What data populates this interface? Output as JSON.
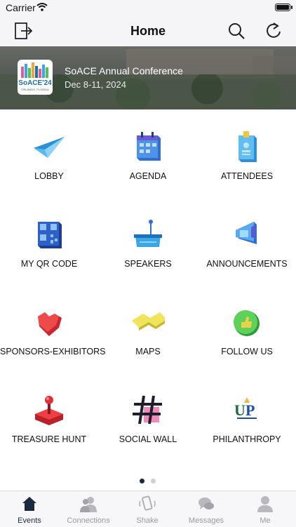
{
  "status_bar": {
    "carrier": "Carrier"
  },
  "navbar": {
    "title": "Home"
  },
  "event": {
    "title": "SoACE Annual Conference",
    "dates": "Dec 8-11, 2024",
    "logo_text": "SoACE'24",
    "logo_subtext": "ORLANDO, FLORIDA"
  },
  "grid": {
    "tiles": [
      {
        "label": "LOBBY",
        "icon": "paper-plane-icon",
        "color": "#3aa6e6"
      },
      {
        "label": "AGENDA",
        "icon": "calendar-icon",
        "color": "#3f7fe0"
      },
      {
        "label": "ATTENDEES",
        "icon": "id-badge-icon",
        "color": "#5ab6e8"
      },
      {
        "label": "MY QR CODE",
        "icon": "qr-code-icon",
        "color": "#3f6fd8"
      },
      {
        "label": "SPEAKERS",
        "icon": "podium-icon",
        "color": "#37a4e3"
      },
      {
        "label": "ANNOUNCEMENTS",
        "icon": "megaphone-icon",
        "color": "#4f8fe0"
      },
      {
        "label": "SPONSORS-EXHIBITORS",
        "icon": "heart-icon",
        "color": "#e83a3a"
      },
      {
        "label": "MAPS",
        "icon": "map-icon",
        "color": "#e9e04a"
      },
      {
        "label": "FOLLOW US",
        "icon": "thumbs-up-icon",
        "color": "#4fc24f"
      },
      {
        "label": "TREASURE HUNT",
        "icon": "joystick-icon",
        "color": "#e03a3a"
      },
      {
        "label": "SOCIAL WALL",
        "icon": "hashtag-icon",
        "color": "#1d1d2e"
      },
      {
        "label": "PHILANTHROPY",
        "icon": "up-logo-icon",
        "color": "#1f6a3a"
      }
    ]
  },
  "pager": {
    "pages": 2,
    "current": 1
  },
  "tabbar": {
    "tabs": [
      {
        "label": "Events",
        "active": true,
        "icon": "home-icon"
      },
      {
        "label": "Connections",
        "active": false,
        "icon": "people-icon"
      },
      {
        "label": "Shake",
        "active": false,
        "icon": "shake-phone-icon"
      },
      {
        "label": "Messages",
        "active": false,
        "icon": "chat-bubbles-icon"
      },
      {
        "label": "Me",
        "active": false,
        "icon": "person-icon"
      }
    ]
  }
}
